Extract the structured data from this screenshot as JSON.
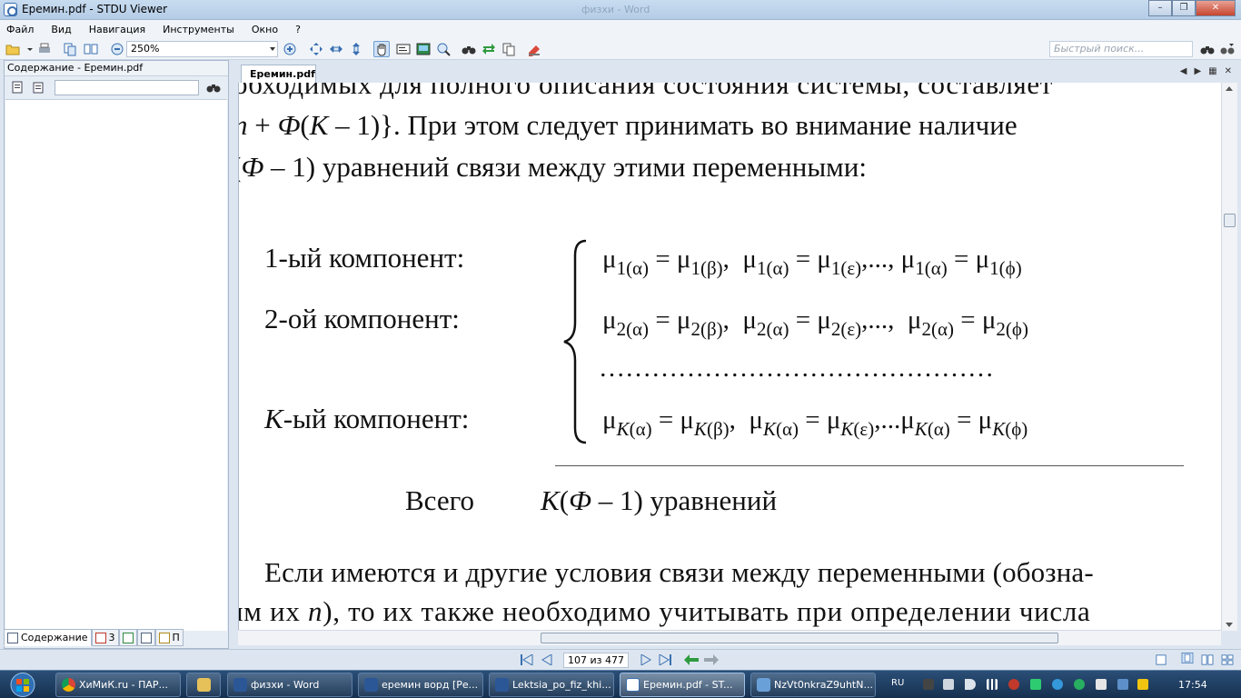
{
  "window": {
    "title": "Еремин.pdf - STDU Viewer",
    "background_title": "физхи - Word"
  },
  "menu": [
    "Файл",
    "Вид",
    "Навигация",
    "Инструменты",
    "Окно",
    "?"
  ],
  "toolbar": {
    "zoom": "250%",
    "search_placeholder": "Быстрый поиск..."
  },
  "left_panel": {
    "title": "Содержание - Еремин.pdf",
    "tabs": {
      "contents": "Содержание",
      "thumbs": "3",
      "search": "П"
    }
  },
  "document": {
    "tab": "Еремин.pdf",
    "lines": {
      "l1": "обходимых для полного описания состояния системы, составляет",
      "l2a": "n",
      "l2b": " + ",
      "l2c": "Ф",
      "l2d": "(",
      "l2e": "К",
      "l2f": " – 1)}. При этом следует принимать во внимание наличие",
      "l3a": "(",
      "l3b": "Ф",
      "l3c": " – 1) уравнений связи между этими переменными:",
      "comp1": "1-ый компонент:",
      "comp2": "2-ой компонент:",
      "compK_a": "K",
      "compK_b": "-ый компонент:",
      "dots": "………………………………………",
      "total_a": "Всего",
      "total_b": "K",
      "total_c": "(",
      "total_d": "Ф",
      "total_e": " – 1) уравнений",
      "p1": "Если имеются и другие условия связи между переменными (обозна-",
      "p2a": "им их ",
      "p2b": "n",
      "p2c": "), то их также необходимо учитывать при определении числа"
    },
    "formulas": {
      "f1": "μ<sub>1(α)</sub> = μ<sub>1(β)</sub>,&nbsp; μ<sub>1(α)</sub> = μ<sub>1(ε)</sub>,..., μ<sub>1(α)</sub> = μ<sub>1(ϕ)</sub>",
      "f2": "μ<sub>2(α)</sub> = μ<sub>2(β)</sub>,&nbsp; μ<sub>2(α)</sub> = μ<sub>2(ε)</sub>,...,&nbsp; μ<sub>2(α)</sub> = μ<sub>2(ϕ)</sub>",
      "fK": "μ<sub><i>K</i>(α)</sub> = μ<sub><i>K</i>(β)</sub>,&nbsp; μ<sub><i>K</i>(α)</sub> = μ<sub><i>K</i>(ε)</sub>,...μ<sub><i>K</i>(α)</sub> = μ<sub><i>K</i>(ϕ)</sub>"
    }
  },
  "status": {
    "page_counter": "107 из 477"
  },
  "taskbar": {
    "items": [
      "ХиМиК.ru - ПАР...",
      "",
      "физхи - Word",
      "еремин ворд [Ре...",
      "Lektsia_po_fiz_khi...",
      "Еремин.pdf - ST...",
      "NzVt0nkraZ9uhtN..."
    ],
    "lang": "RU",
    "clock": "17:54"
  },
  "colors": {
    "accent": "#3a6fb0",
    "taskbar": "#1f3f63"
  }
}
